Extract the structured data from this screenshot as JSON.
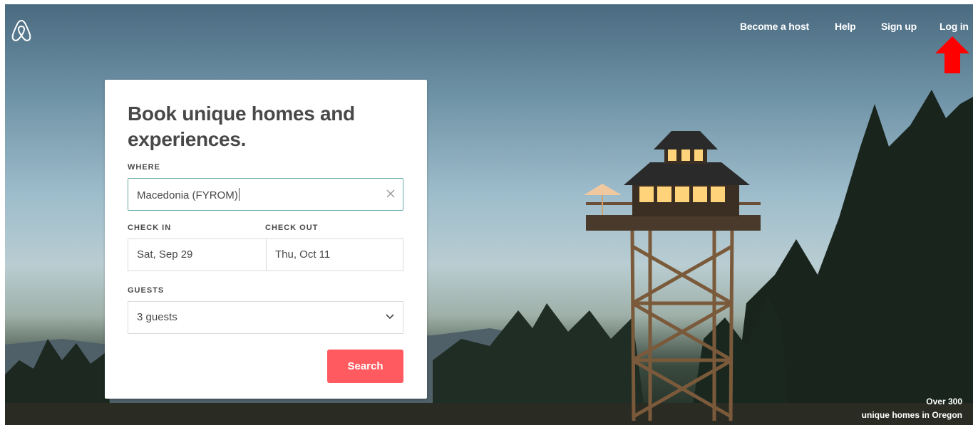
{
  "nav": {
    "items": [
      "Become a host",
      "Help",
      "Sign up",
      "Log in"
    ]
  },
  "booking": {
    "title": "Book unique homes and experiences.",
    "where_label": "WHERE",
    "where_value": "Macedonia (FYROM)",
    "check_in_label": "CHECK IN",
    "check_in_value": "Sat, Sep 29",
    "check_out_label": "CHECK OUT",
    "check_out_value": "Thu, Oct 11",
    "guests_label": "GUESTS",
    "guests_value": "3 guests",
    "search_label": "Search"
  },
  "caption": {
    "line1": "Over 300",
    "line2": "unique homes in Oregon"
  },
  "colors": {
    "accent": "#ff5a5f",
    "input_focus": "#66a9a6",
    "annotation_arrow": "#ff0000"
  },
  "icons": {
    "logo": "airbnb-logo-icon",
    "clear": "close-icon",
    "dropdown": "chevron-down-icon",
    "annotation": "arrow-up-icon"
  }
}
